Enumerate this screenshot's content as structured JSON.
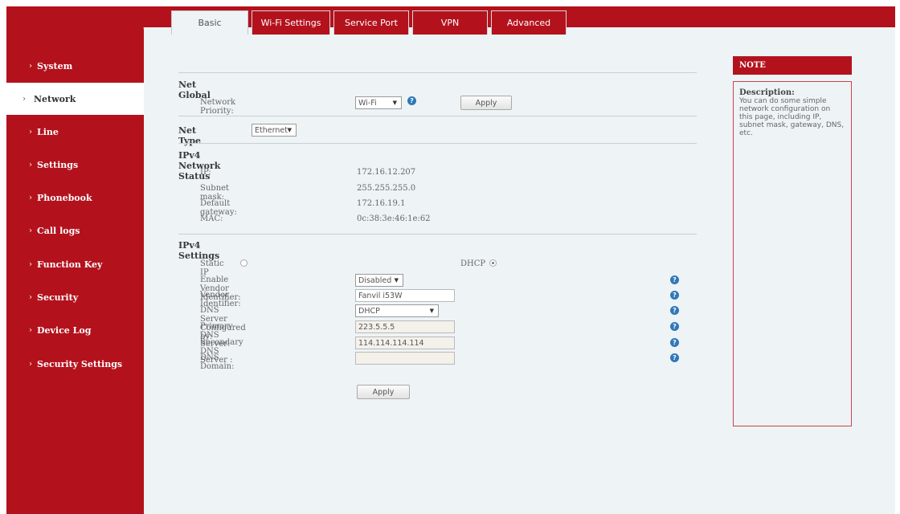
{
  "tabs": [
    {
      "label": "Basic",
      "active": true
    },
    {
      "label": "Wi-Fi Settings",
      "active": false
    },
    {
      "label": "Service Port",
      "active": false
    },
    {
      "label": "VPN",
      "active": false
    },
    {
      "label": "Advanced",
      "active": false
    }
  ],
  "sidebar": {
    "items": [
      {
        "label": "System"
      },
      {
        "label": "Network",
        "active": true
      },
      {
        "label": "Line"
      },
      {
        "label": "Settings"
      },
      {
        "label": "Phonebook"
      },
      {
        "label": "Call logs"
      },
      {
        "label": "Function Key"
      },
      {
        "label": "Security"
      },
      {
        "label": "Device Log"
      },
      {
        "label": "Security Settings"
      }
    ],
    "chevron": "›"
  },
  "net_global": {
    "title": "Net Global",
    "priority_label": "Network Priority:",
    "priority_value": "Wi-Fi",
    "apply_label": "Apply"
  },
  "net_type": {
    "label": "Net Type",
    "value": "Ethernet"
  },
  "ipv4_status": {
    "title": "IPv4 Network Status",
    "rows": [
      {
        "label": "IP:",
        "value": "172.16.12.207"
      },
      {
        "label": "Subnet mask:",
        "value": "255.255.255.0"
      },
      {
        "label": "Default gateway:",
        "value": "172.16.19.1"
      },
      {
        "label": "MAC:",
        "value": "0c:38:3e:46:1e:62"
      }
    ]
  },
  "ipv4_settings": {
    "title": "IPv4 Settings",
    "static_ip_label": "Static IP",
    "dhcp_label": "DHCP",
    "mode": "DHCP",
    "enable_vendor_label": "Enable Vendor Identifier:",
    "enable_vendor_value": "Disabled",
    "vendor_label": "Vendor Identifier:",
    "vendor_value": "Fanvil i53W",
    "dns_by_label": "DNS Server Configured by:",
    "dns_by_value": "DHCP",
    "primary_dns_label": "Primary DNS Server:",
    "primary_dns_value": "223.5.5.5",
    "secondary_dns_label": "Secondary DNS Server :",
    "secondary_dns_value": "114.114.114.114",
    "dns_domain_label": "DNS Domain:",
    "dns_domain_value": "",
    "apply_label": "Apply"
  },
  "note": {
    "header": "NOTE",
    "title": "Description:",
    "text": "You can do some simple network configuration on this page, including IP, subnet mask, gateway, DNS, etc."
  },
  "icons": {
    "help": "?",
    "dropdown_arrow": "▼"
  },
  "colors": {
    "brand_red": "#b3121d",
    "background": "#eef3f6",
    "help_blue": "#2f78b8"
  }
}
